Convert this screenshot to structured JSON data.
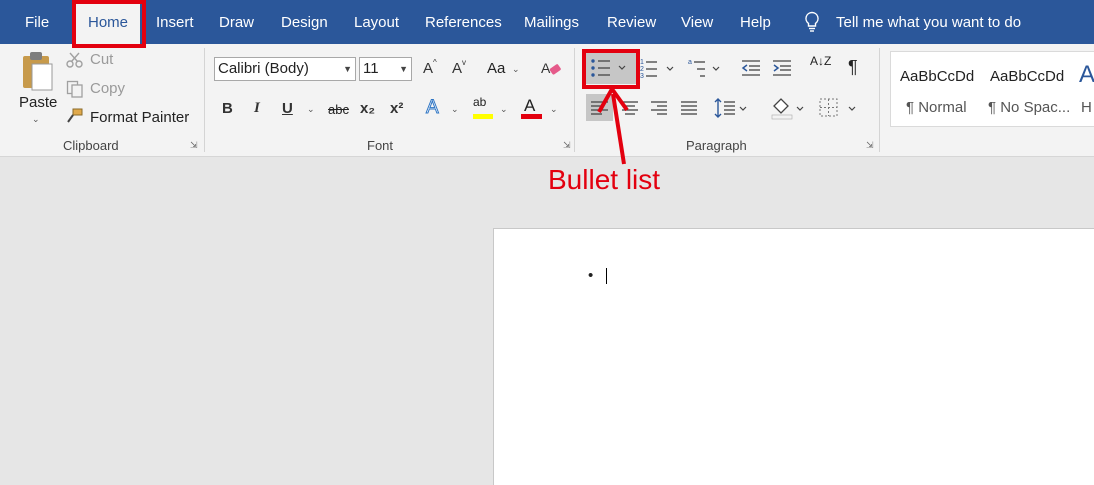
{
  "colors": {
    "accent": "#2b579a",
    "annotation": "#e3000f"
  },
  "tabs": [
    {
      "label": "File"
    },
    {
      "label": "Home",
      "active": true
    },
    {
      "label": "Insert"
    },
    {
      "label": "Draw"
    },
    {
      "label": "Design"
    },
    {
      "label": "Layout"
    },
    {
      "label": "References"
    },
    {
      "label": "Mailings"
    },
    {
      "label": "Review"
    },
    {
      "label": "View"
    },
    {
      "label": "Help"
    }
  ],
  "tell_me": {
    "icon": "lightbulb-icon",
    "text": "Tell me what you want to do"
  },
  "clipboard": {
    "group_label": "Clipboard",
    "paste_label": "Paste",
    "cut_label": "Cut",
    "copy_label": "Copy",
    "format_painter_label": "Format Painter"
  },
  "font": {
    "group_label": "Font",
    "font_name": "Calibri (Body)",
    "font_size": "11",
    "bold": "B",
    "italic": "I",
    "underline": "U",
    "strikethrough": "abc",
    "subscript": "x₂",
    "superscript": "x²",
    "grow": "A",
    "shrink": "A",
    "change_case": "Aa",
    "effects": "A",
    "highlight": "ab",
    "font_color": "A"
  },
  "paragraph": {
    "group_label": "Paragraph",
    "pilcrow": "¶",
    "sort": "A↓Z"
  },
  "styles": {
    "items": [
      {
        "preview": "AaBbCcDd",
        "label": "¶ Normal"
      },
      {
        "preview": "AaBbCcDd",
        "label": "¶ No Spac..."
      },
      {
        "preview": "A",
        "label": "H"
      }
    ]
  },
  "document": {
    "bullet": "•"
  },
  "annotation": {
    "label": "Bullet list"
  }
}
